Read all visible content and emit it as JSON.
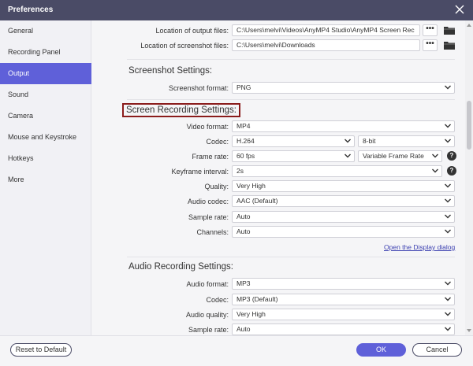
{
  "window": {
    "title": "Preferences"
  },
  "sidebar": {
    "items": [
      {
        "label": "General"
      },
      {
        "label": "Recording Panel"
      },
      {
        "label": "Output"
      },
      {
        "label": "Sound"
      },
      {
        "label": "Camera"
      },
      {
        "label": "Mouse and Keystroke"
      },
      {
        "label": "Hotkeys"
      },
      {
        "label": "More"
      }
    ],
    "active": "Output"
  },
  "output_files": {
    "location_output_label": "Location of output files:",
    "location_output_value": "C:\\Users\\melvi\\Videos\\AnyMP4 Studio\\AnyMP4 Screen Rec",
    "location_screenshot_label": "Location of screenshot files:",
    "location_screenshot_value": "C:\\Users\\melvi\\Downloads",
    "browse_label": "•••"
  },
  "screenshot_settings": {
    "title": "Screenshot Settings:",
    "format_label": "Screenshot format:",
    "format_value": "PNG"
  },
  "screen_recording_settings": {
    "title": "Screen Recording Settings:",
    "video_format_label": "Video format:",
    "video_format_value": "MP4",
    "codec_label": "Codec:",
    "codec_value": "H.264",
    "bit_depth_value": "8-bit",
    "frame_rate_label": "Frame rate:",
    "frame_rate_value": "60 fps",
    "frame_rate_mode_value": "Variable Frame Rate",
    "keyframe_label": "Keyframe interval:",
    "keyframe_value": "2s",
    "quality_label": "Quality:",
    "quality_value": "Very High",
    "audio_codec_label": "Audio codec:",
    "audio_codec_value": "AAC (Default)",
    "sample_rate_label": "Sample rate:",
    "sample_rate_value": "Auto",
    "channels_label": "Channels:",
    "channels_value": "Auto",
    "display_dialog_link": "Open the Display dialog"
  },
  "audio_recording_settings": {
    "title": "Audio Recording Settings:",
    "audio_format_label": "Audio format:",
    "audio_format_value": "MP3",
    "codec_label": "Codec:",
    "codec_value": "MP3 (Default)",
    "audio_quality_label": "Audio quality:",
    "audio_quality_value": "Very High",
    "sample_rate_label": "Sample rate:",
    "sample_rate_value": "Auto"
  },
  "help_glyph": "?",
  "footer": {
    "reset_label": "Reset to Default",
    "ok_label": "OK",
    "cancel_label": "Cancel"
  },
  "colors": {
    "titlebar": "#4a4b66",
    "accent": "#5f60d9",
    "highlight_box": "#8b1c1c"
  }
}
